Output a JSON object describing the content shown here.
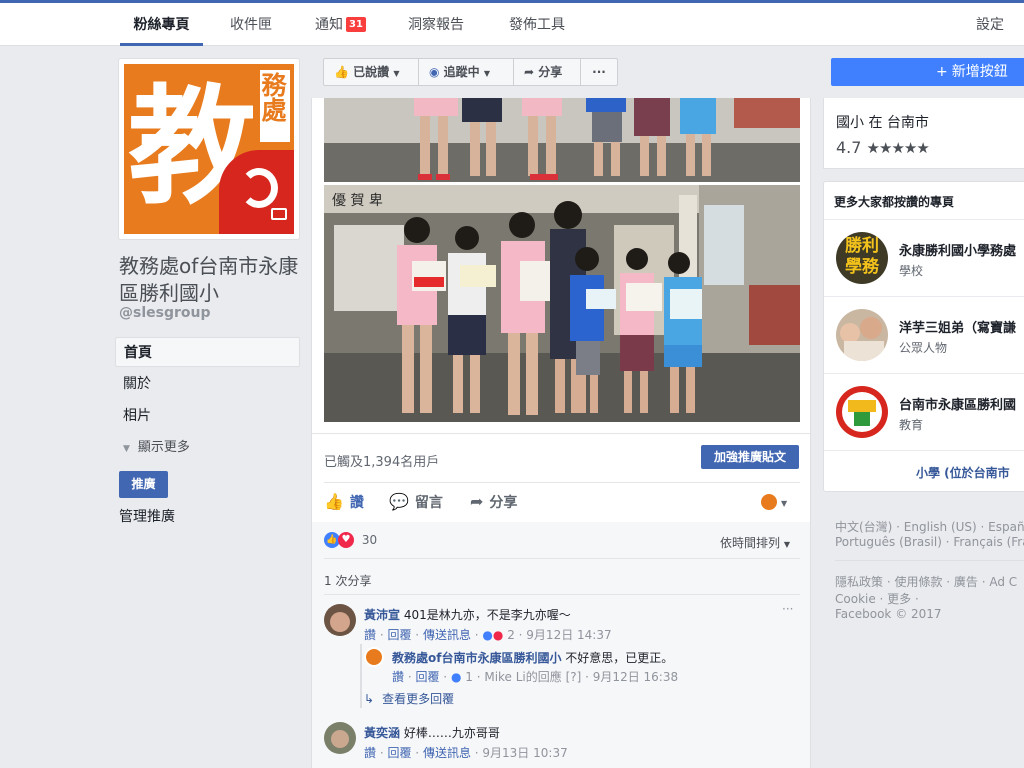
{
  "topnav": {
    "tabs": [
      "粉絲專頁",
      "收件匣",
      "通知",
      "洞察報告",
      "發佈工具"
    ],
    "notif_count": "31",
    "settings": "設定"
  },
  "page": {
    "avatar_text_big": "教",
    "avatar_text_small": "務處",
    "name": "教務處of台南市永康區勝利國小",
    "handle": "@slesgroup"
  },
  "left_nav": {
    "items": [
      "首頁",
      "關於",
      "相片"
    ],
    "show_more": "顯示更多",
    "promote": "推廣",
    "manage_promotions": "管理推廣"
  },
  "toolbar": {
    "liked": "已說讚",
    "following": "追蹤中",
    "share": "分享",
    "more": "···",
    "add_button": "新增按鈕"
  },
  "post": {
    "reach": "已觸及1,394名用戶",
    "boost": "加強推廣貼文",
    "like": "讚",
    "comment": "留言",
    "share": "分享",
    "reaction_count": "30",
    "sort": "依時間排列",
    "shares": "1 次分享",
    "sign_text": "優 賀 卑"
  },
  "comments": [
    {
      "name": "黃沛宣",
      "text": "401是林九亦，不是李九亦喔～",
      "like": "讚",
      "reply": "回覆",
      "message": "傳送訊息",
      "reactions": "2",
      "time": "9月12日 14:37"
    },
    {
      "name": "教務處of台南市永康區勝利國小",
      "text": "不好意思，已更正。",
      "like": "讚",
      "reply": "回覆",
      "reactions": "1",
      "replied_by": "Mike Li的回應",
      "help": "[?]",
      "time": "9月12日 16:38"
    },
    {
      "name": "黃奕涵",
      "text": "好棒……九亦哥哥",
      "like": "讚",
      "reply": "回覆",
      "message": "傳送訊息",
      "time": "9月13日 10:37"
    }
  ],
  "more_replies": "查看更多回覆",
  "right": {
    "category": "國小 在 台南市",
    "rating": "4.7",
    "stars": "★★★★★",
    "liked_pages_title": "更多大家都按讚的專頁",
    "liked_pages": [
      {
        "name": "永康勝利國小學務處",
        "category": "學校",
        "logo_text": "勝利學務"
      },
      {
        "name": "洋芋三姐弟（寫寶謙",
        "category": "公眾人物"
      },
      {
        "name": "台南市永康區勝利國",
        "category": "教育"
      }
    ],
    "more_link": "小學 (位於台南市"
  },
  "footer": {
    "langs1": "中文(台灣) · English (US) · Españ",
    "langs2": "Português (Brasil) · Français (Fra",
    "links1": "隱私政策 · 使用條款 · 廣告 · Ad C",
    "links2": "Cookie · 更多 ·",
    "copyright": "Facebook © 2017"
  },
  "colors": {
    "brand": "#4267b2",
    "cta": "#4080ff",
    "avatar_orange": "#e87b1e",
    "avatar_red": "#d7261e",
    "badge": "#fa3e3e"
  }
}
